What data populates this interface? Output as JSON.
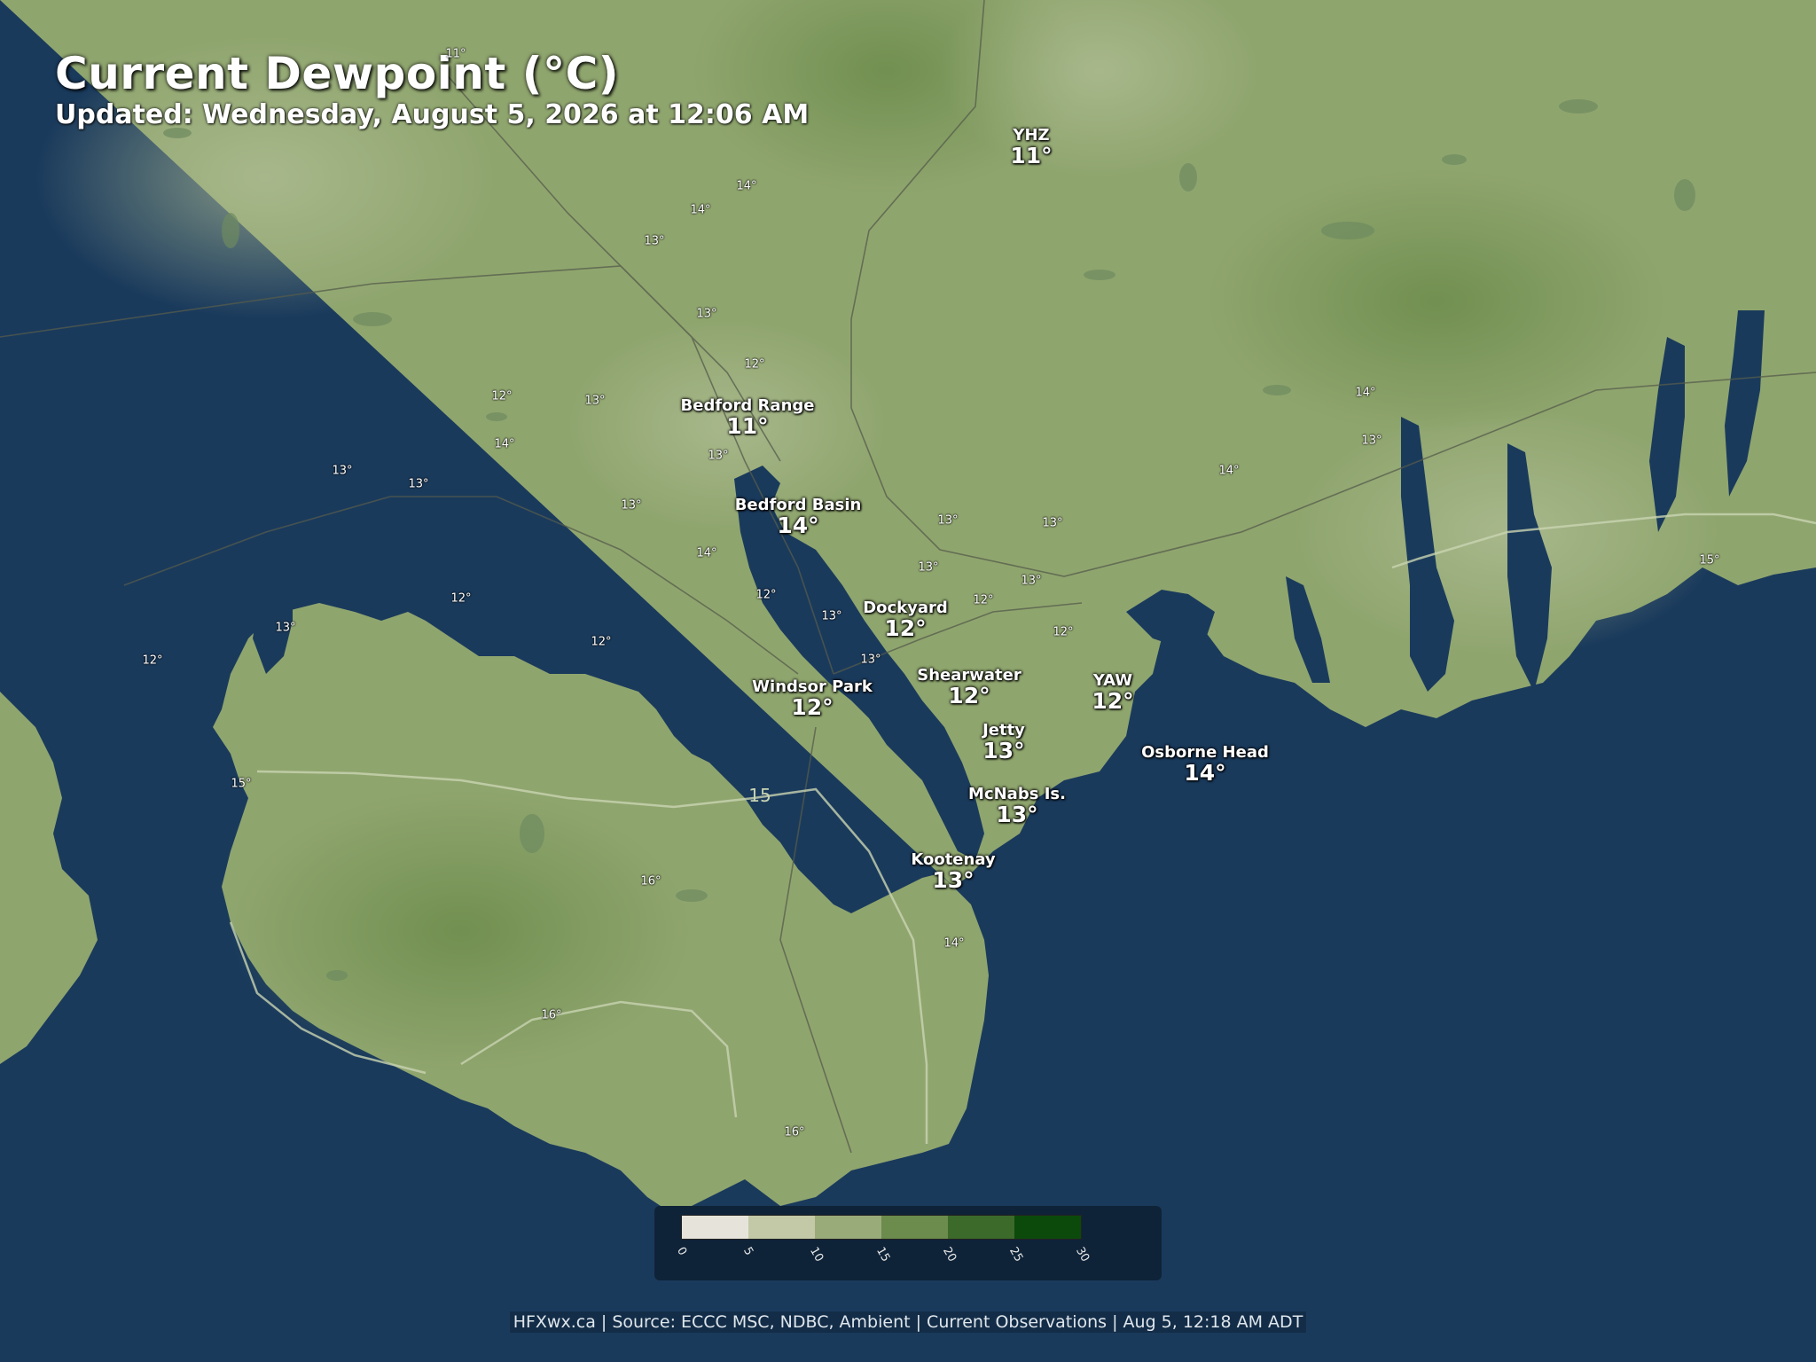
{
  "header": {
    "title": "Current Dewpoint (°C)",
    "updated": "Updated: Wednesday, August 5, 2026 at 12:06 AM"
  },
  "stations": [
    {
      "name": "YHZ",
      "value": "11°"
    },
    {
      "name": "Bedford Range",
      "value": "11°"
    },
    {
      "name": "Bedford Basin",
      "value": "14°"
    },
    {
      "name": "Dockyard",
      "value": "12°"
    },
    {
      "name": "Shearwater",
      "value": "12°"
    },
    {
      "name": "YAW",
      "value": "12°"
    },
    {
      "name": "Windsor Park",
      "value": "12°"
    },
    {
      "name": "Jetty",
      "value": "13°"
    },
    {
      "name": "Osborne Head",
      "value": "14°"
    },
    {
      "name": "McNabs Is.",
      "value": "13°"
    },
    {
      "name": "Kootenay",
      "value": "13°"
    }
  ],
  "grid_labels": [
    "11°",
    "14°",
    "14°",
    "13°",
    "13°",
    "12°",
    "12°",
    "13°",
    "13°",
    "14°",
    "13°",
    "13°",
    "14°",
    "12°",
    "13°",
    "13°",
    "12°",
    "13°",
    "13°",
    "12°",
    "12°",
    "13°",
    "12°",
    "14°",
    "13°",
    "14°",
    "13°",
    "13°",
    "15°",
    "12°",
    "13°",
    "15°",
    "16°",
    "14°",
    "16°",
    "16°"
  ],
  "contour_label": "15",
  "legend": {
    "colors": [
      "#e6e3da",
      "#c3c8a6",
      "#9aab7a",
      "#6b8c4c",
      "#3c6a2a",
      "#0b4a0b"
    ],
    "ticks": [
      "0",
      "5",
      "10",
      "15",
      "20",
      "25",
      "30"
    ]
  },
  "map_colors": {
    "water": "#1a3a5c",
    "land_base": "#8fa56e",
    "land_dark": "#6f8f50",
    "land_light": "#a6b689"
  },
  "footer": "HFXwx.ca | Source: ECCC MSC, NDBC, Ambient | Current Observations | Aug 5, 12:18 AM ADT"
}
